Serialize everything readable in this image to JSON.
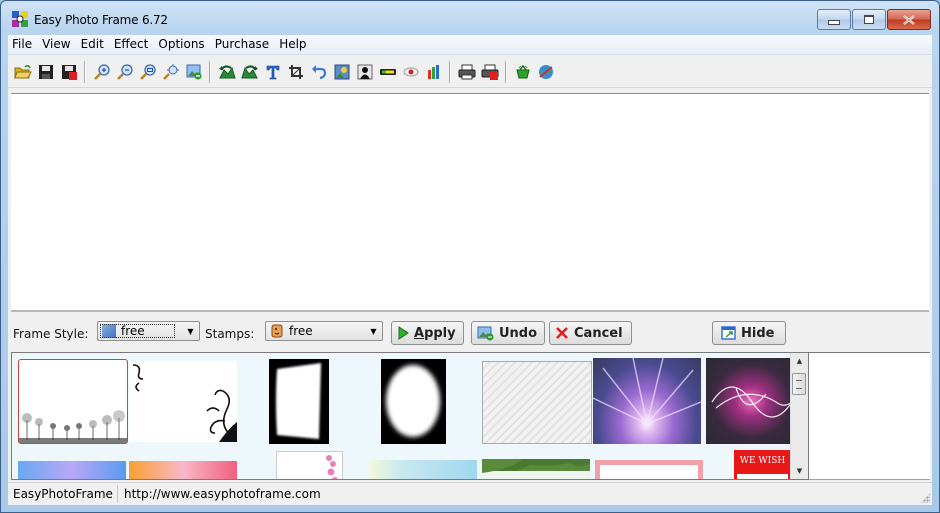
{
  "window": {
    "title": "Easy Photo Frame 6.72",
    "controls": [
      "minimize",
      "maximize",
      "close"
    ]
  },
  "menu": [
    "File",
    "View",
    "Edit",
    "Effect",
    "Options",
    "Purchase",
    "Help"
  ],
  "toolbar": {
    "groups": [
      [
        "open-folder-icon",
        "save-icon",
        "save-as-icon"
      ],
      [
        "zoom-in-icon",
        "zoom-out-icon",
        "zoom-fit-icon",
        "zoom-actual-icon",
        "insert-image-icon"
      ],
      [
        "rotate-left-icon",
        "rotate-right-icon",
        "text-icon",
        "crop-icon",
        "undo-arrow-icon",
        "photo-effect-icon",
        "silhouette-icon",
        "levels-icon",
        "red-eye-icon",
        "histogram-icon"
      ],
      [
        "print-icon",
        "print-setup-icon"
      ],
      [
        "shopping-basket-icon",
        "web-globe-icon"
      ]
    ]
  },
  "controls": {
    "frame_style_label": "Frame Style:",
    "frame_style_value": "free",
    "stamps_label": "Stamps:",
    "stamps_value": "free",
    "apply_label_underlined": "A",
    "apply_label_rest": "pply",
    "undo_label": "Undo",
    "cancel_label": "Cancel",
    "hide_label": "Hide"
  },
  "gallery": {
    "items": [
      {
        "name": "dandelion-frame",
        "selected": true
      },
      {
        "name": "swirl-vine-frame",
        "selected": false
      },
      {
        "name": "rough-edge-mask",
        "selected": false
      },
      {
        "name": "oval-edge-mask",
        "selected": false
      },
      {
        "name": "white-texture-frame",
        "selected": false
      },
      {
        "name": "purple-light-burst",
        "selected": false
      },
      {
        "name": "neon-light-swirl",
        "selected": false
      },
      {
        "name": "blue-butterfly-frame",
        "selected": false
      },
      {
        "name": "orange-pink-butterfly-frame",
        "selected": false
      },
      {
        "name": "pink-flower-frame",
        "selected": false
      },
      {
        "name": "light-blue-floral-frame",
        "selected": false
      },
      {
        "name": "green-leaves-frame",
        "selected": false
      },
      {
        "name": "pink-border-frame",
        "selected": false
      },
      {
        "name": "we-wish-card-frame",
        "selected": false
      }
    ],
    "we_wish_text": "WE WISH"
  },
  "statusbar": {
    "app_name": "EasyPhotoFrame",
    "url": "http://www.easyphotoframe.com"
  },
  "colors": {
    "selection_border": "#d04040",
    "gallery_bg": "#eef7fc",
    "close_button": "#c9452a"
  }
}
